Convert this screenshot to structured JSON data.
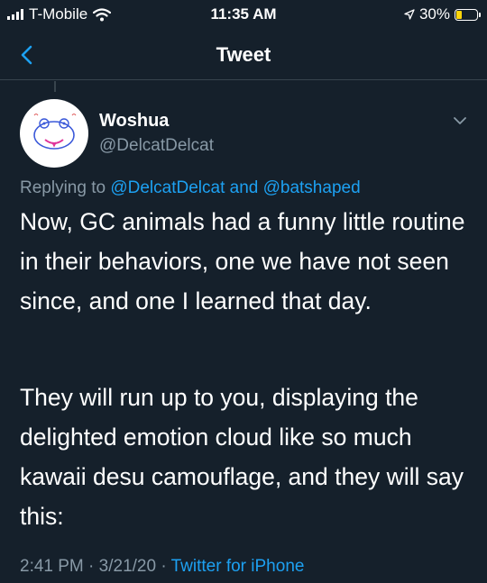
{
  "status_bar": {
    "carrier": "T-Mobile",
    "time": "11:35 AM",
    "battery": "30%",
    "battery_level": 0.3
  },
  "nav": {
    "title": "Tweet"
  },
  "tweet": {
    "name": "Woshua",
    "handle": "@DelcatDelcat",
    "replying_prefix": "Replying to",
    "reply_to_1": "@DelcatDelcat",
    "reply_and": "and",
    "reply_to_2": "@batshaped",
    "paragraphs": [
      "Now, GC animals had a funny little routine in their behaviors, one we have not seen since, and one I learned that day.",
      "They will run up to you, displaying the delighted emotion cloud like so much kawaii desu camouflage, and they will say this:"
    ],
    "time": "2:41 PM",
    "date": "3/21/20",
    "source": "Twitter for iPhone"
  },
  "colors": {
    "background": "#15202b",
    "accent": "#1da1f2",
    "secondary_text": "#8899a6",
    "battery": "#ffd60a"
  },
  "icons": [
    "signal-icon",
    "wifi-icon",
    "location-arrow-icon",
    "battery-icon",
    "back-chevron-icon",
    "chevron-down-icon"
  ]
}
